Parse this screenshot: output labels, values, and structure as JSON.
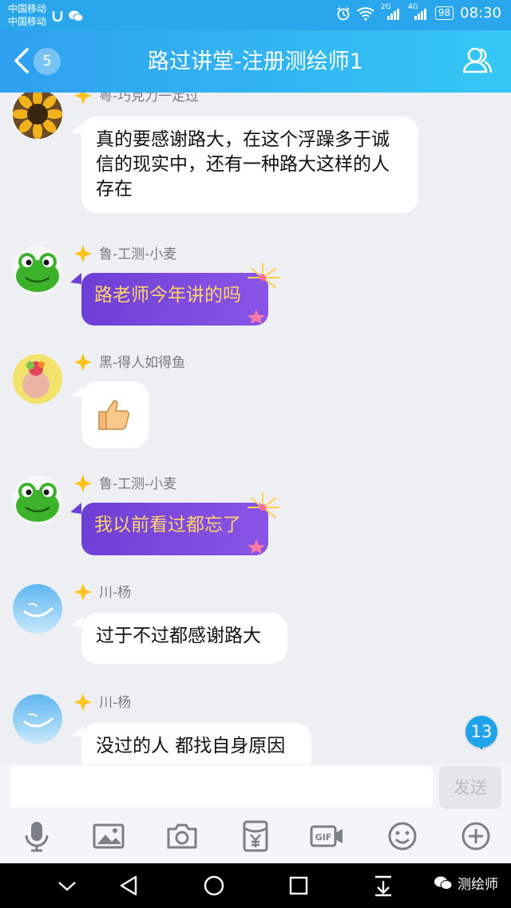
{
  "status_bar": {
    "carrier_1": "中国移动",
    "carrier_2": "中国移动",
    "network_1": "2G",
    "network_2": "4G",
    "battery": "98",
    "time": "08:30"
  },
  "header": {
    "unread_count": "5",
    "title": "路过讲堂-注册测绘师1"
  },
  "messages": [
    {
      "sender": "粤-巧克力一定过",
      "text": "真的要感谢路大，在这个浮躁多于诚信的现实中，还有一种路大这样的人存在"
    },
    {
      "sender": "鲁-工测-小麦",
      "text": "路老师今年讲的吗"
    },
    {
      "sender": "黑-得人如得鱼",
      "text": "👍"
    },
    {
      "sender": "鲁-工测-小麦",
      "text": "我以前看过都忘了"
    },
    {
      "sender": "川-杨",
      "text": "过于不过都感谢路大"
    },
    {
      "sender": "川-杨",
      "text": "没过的人 都找自身原因"
    }
  ],
  "new_message_count": "13",
  "composer": {
    "input_value": "",
    "send_label": "发送"
  },
  "toolbar_icons": [
    "microphone-icon",
    "image-icon",
    "camera-icon",
    "red-packet-icon",
    "gif-icon",
    "emoji-icon",
    "plus-icon"
  ],
  "watermark": "测绘师",
  "colors": {
    "header_blue": "#2fa0ef",
    "purple_bubble": "#7a4ade",
    "purple_bubble_text": "#ffd26a",
    "background": "#eeeff3"
  }
}
